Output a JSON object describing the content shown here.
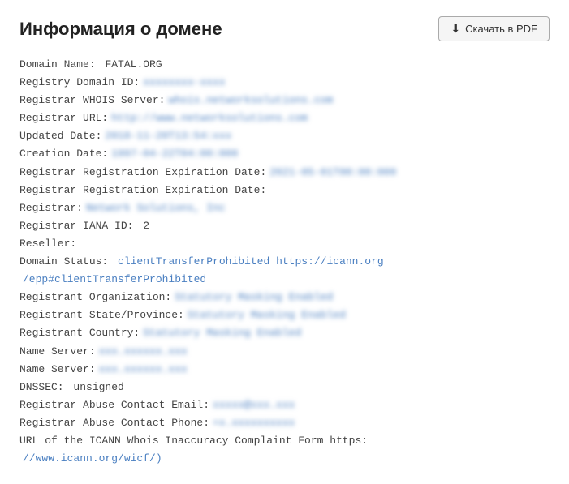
{
  "header": {
    "title": "Информация о домене",
    "download_label": "Скачать в PDF"
  },
  "whois": {
    "domain_name_label": "Domain Name:",
    "domain_name_value": "FATAL.ORG",
    "registry_id_label": "Registry Domain ID:",
    "registry_id_value": "xxxxxxxx-xxxx",
    "registrar_whois_label": "Registrar WHOIS Server:",
    "registrar_whois_value": "whois.networksolutions.com",
    "registrar_url_label": "Registrar URL:",
    "registrar_url_value": "http://www.networksolutions.com",
    "updated_date_label": "Updated Date:",
    "updated_date_value": "2018-11-20T13:54:xxx",
    "creation_date_label": "Creation Date:",
    "creation_date_value": "1997-04-22T04:00:000",
    "expiration_date_label1": "Registrar Registration Expiration Date:",
    "expiration_date_value1": "2021-05-01T00:00:000",
    "expiration_date_label2": "Registrar Registration Expiration Date:",
    "expiration_date_value2": "",
    "registrar_label": "Registrar:",
    "registrar_value": "Network Solutions, Inc",
    "iana_id_label": "Registrar IANA ID:",
    "iana_id_value": "2",
    "reseller_label": "Reseller:",
    "reseller_value": "",
    "domain_status_label": "Domain Status:",
    "domain_status_value": "clientTransferProhibited https://icann.org",
    "domain_status_value2": "/epp#clientTransferProhibited",
    "registrant_org_label": "Registrant Organization:",
    "registrant_org_value": "Statutory Masking Enabled",
    "registrant_state_label": "Registrant State/Province:",
    "registrant_state_value": "Statutory Masking Enabled",
    "registrant_country_label": "Registrant Country:",
    "registrant_country_value": "Statutory Masking Enabled",
    "name_server1_label": "Name Server:",
    "name_server1_value": "xxx.xxxxxx.xxx",
    "name_server2_label": "Name Server:",
    "name_server2_value": "xxx.xxxxxx.xxx",
    "dnssec_label": "DNSSEC:",
    "dnssec_value": "unsigned",
    "abuse_email_label": "Registrar Abuse Contact Email:",
    "abuse_email_value": "xxxxx@xxx.xxx",
    "abuse_phone_label": "Registrar Abuse Contact Phone:",
    "abuse_phone_value": "+x.xxxxxxxxxx",
    "icann_label": "URL of the ICANN Whois Inaccuracy Complaint Form https:",
    "icann_value": "//www.icann.org/wicf/)"
  }
}
